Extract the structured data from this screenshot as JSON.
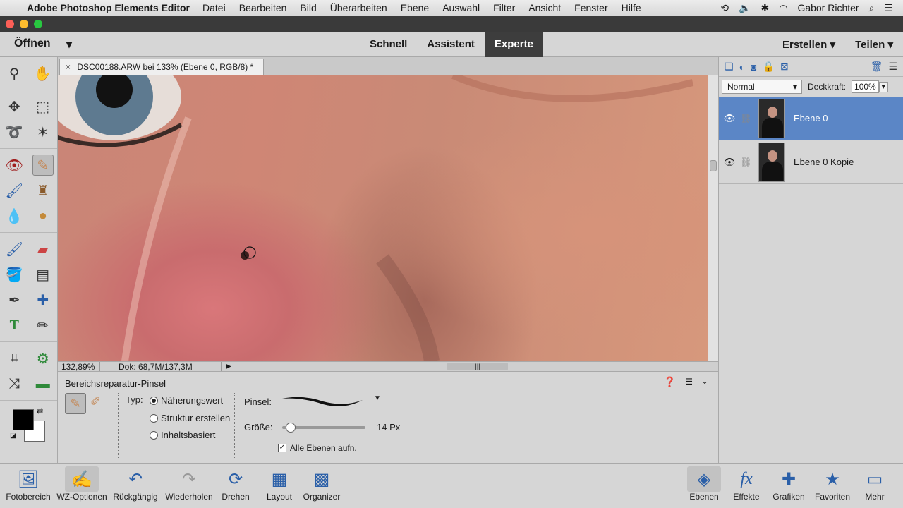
{
  "menubar": {
    "app_name": "Adobe Photoshop Elements Editor",
    "items": [
      "Datei",
      "Bearbeiten",
      "Bild",
      "Überarbeiten",
      "Ebene",
      "Auswahl",
      "Filter",
      "Ansicht",
      "Fenster",
      "Hilfe"
    ],
    "user": "Gabor Richter"
  },
  "topbar": {
    "open_label": "Öffnen",
    "modes": [
      "Schnell",
      "Assistent",
      "Experte"
    ],
    "active_mode": "Experte",
    "create_label": "Erstellen",
    "share_label": "Teilen"
  },
  "document": {
    "tab_title": "DSC00188.ARW bei 133% (Ebene 0, RGB/8) *",
    "close": "×"
  },
  "status": {
    "zoom": "132,89%",
    "doc": "Dok: 68,7M/137,3M"
  },
  "options": {
    "title": "Bereichsreparatur-Pinsel",
    "type_label": "Typ:",
    "types": [
      "Näherungswert",
      "Struktur erstellen",
      "Inhaltsbasiert"
    ],
    "selected_type": "Näherungswert",
    "brush_label": "Pinsel:",
    "size_label": "Größe:",
    "size_value": "14 Px",
    "size_fraction": 0.05,
    "all_layers_label": "Alle Ebenen aufn.",
    "all_layers_checked": true
  },
  "layers_panel": {
    "blend_mode": "Normal",
    "opacity_label": "Deckkraft:",
    "opacity_value": "100%",
    "layers": [
      {
        "name": "Ebene 0",
        "active": true
      },
      {
        "name": "Ebene 0 Kopie",
        "active": false
      }
    ]
  },
  "bottombar": {
    "items": [
      {
        "label": "Fotobereich",
        "icon": "photo-bin-icon"
      },
      {
        "label": "WZ-Optionen",
        "icon": "tool-options-icon"
      },
      {
        "label": "Rückgängig",
        "icon": "undo-icon"
      },
      {
        "label": "Wiederholen",
        "icon": "redo-icon"
      },
      {
        "label": "Drehen",
        "icon": "rotate-icon"
      },
      {
        "label": "Layout",
        "icon": "layout-icon"
      },
      {
        "label": "Organizer",
        "icon": "organizer-icon"
      },
      {
        "label": "Ebenen",
        "icon": "layers-icon"
      },
      {
        "label": "Effekte",
        "icon": "effects-icon"
      },
      {
        "label": "Grafiken",
        "icon": "graphics-icon"
      },
      {
        "label": "Favoriten",
        "icon": "favorites-icon"
      },
      {
        "label": "Mehr",
        "icon": "more-icon"
      }
    ]
  },
  "colors": {
    "accent": "#5b86c6",
    "panel_bg": "#d6d6d6",
    "icon_blue": "#2a5fa8"
  }
}
